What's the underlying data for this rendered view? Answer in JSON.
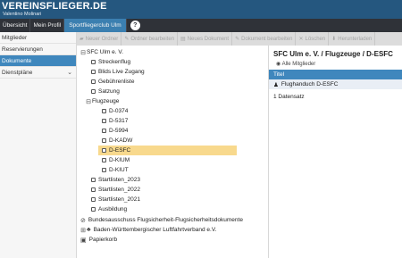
{
  "header": {
    "brand": "VEREINSFLIEGER.DE",
    "user": "Valentino Molinari"
  },
  "nav": {
    "items": [
      "Übersicht",
      "Mein Profil"
    ],
    "club": "Sportfliegerclub Ulm",
    "help": "?"
  },
  "sidebar": {
    "items": [
      {
        "label": "Mitglieder"
      },
      {
        "label": "Reservierungen"
      },
      {
        "label": "Dokumente",
        "active": true
      },
      {
        "label": "Dienstpläne",
        "chevron": "⌄"
      }
    ]
  },
  "toolbar": {
    "buttons": [
      {
        "icon": "▰",
        "label": "Neuer Ordner"
      },
      {
        "icon": "✎",
        "label": "Ordner bearbeiten"
      },
      {
        "icon": "▤",
        "label": "Neues Dokument"
      },
      {
        "icon": "✎",
        "label": "Dokument bearbeiten"
      },
      {
        "icon": "✕",
        "label": "Löschen"
      },
      {
        "icon": "⬇",
        "label": "Herunterladen"
      }
    ]
  },
  "tree": {
    "root": "SFC Ulm e. V.",
    "n1": "Streckenflug",
    "n2": "Blids Live Zugang",
    "n3": "Gebührenliste",
    "n4": "Satzung",
    "n5": "Flugzeuge",
    "f1": "D-0374",
    "f2": "D-5317",
    "f3": "D-5994",
    "f4": "D-KADW",
    "f5": "D-ESFC",
    "f6": "D-KIUM",
    "f7": "D-KIUT",
    "n6": "Startlisten_2023",
    "n7": "Startlisten_2022",
    "n8": "Startlisten_2021",
    "n9": "Ausbildung",
    "t2": "Bundesausschuss Flugsicherheit-Flugsicherheitsdokumente",
    "t3": "Baden-Württembergischer Luftfahrtverband e.V.",
    "t4": "Papierkorb"
  },
  "right": {
    "title": "SFC Ulm e. V. / Flugzeuge / D-ESFC",
    "link": "Alle Mitglieder",
    "column": "Titel",
    "row": "Flughanduch D-ESFC",
    "count": "1 Datensatz"
  }
}
